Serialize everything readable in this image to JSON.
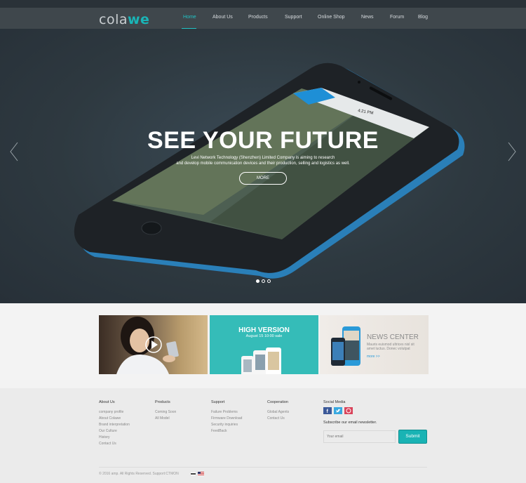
{
  "brand": {
    "logo_part1": "cola",
    "logo_part2": "we",
    "accent": "#19b5b7"
  },
  "nav": {
    "items": [
      {
        "label": "Home",
        "active": true
      },
      {
        "label": "About Us"
      },
      {
        "label": "Products"
      },
      {
        "label": "Support"
      },
      {
        "label": "Online Shop"
      },
      {
        "label": "News"
      },
      {
        "label": "Forum"
      },
      {
        "label": "Blog"
      }
    ]
  },
  "hero": {
    "title": "SEE YOUR FUTURE",
    "subtitle_line1": "Levi Network Technology (Shenzhen) Limited Company is aiming to research",
    "subtitle_line2": "and develop mobile communication devices and their production, selling and logistics as well.",
    "more_label": "MORE",
    "phone_time": "4:21 PM",
    "slides": 3,
    "active_slide": 1
  },
  "cards": {
    "card2_title": "HIGH VERSION",
    "card2_sub": "August 15  10:00 sale",
    "card3_title": "NEWS CENTER",
    "card3_text1": "Mauris euismod ultrices nisl sit",
    "card3_text2": "amet luctus. Donec volutpat",
    "card3_link": "more >>"
  },
  "footer": {
    "about": {
      "title": "About Us",
      "items": [
        "company profile",
        "About Colawe",
        "Brand interpretation",
        "Our Culture",
        "History",
        "Contact Us"
      ]
    },
    "products": {
      "title": "Products",
      "items": [
        "Coming Soon",
        "All Model"
      ]
    },
    "support": {
      "title": "Support",
      "items": [
        "Failure Problems",
        "Firmware Download",
        "Security inquiries",
        "FeedBack"
      ]
    },
    "cooperation": {
      "title": "Cooperation",
      "items": [
        "Global Agents",
        "Contact Us"
      ]
    },
    "social": {
      "title": "Social Media",
      "icons": [
        "facebook-icon",
        "twitter-icon",
        "pinterest-icon"
      ]
    },
    "newsletter_label": "Subscribe our email newsletter.",
    "email_placeholder": "Your email",
    "submit_label": "Submit",
    "copyright": "© 2016 amp. All Rights Reserved.    Support:CTMON"
  }
}
